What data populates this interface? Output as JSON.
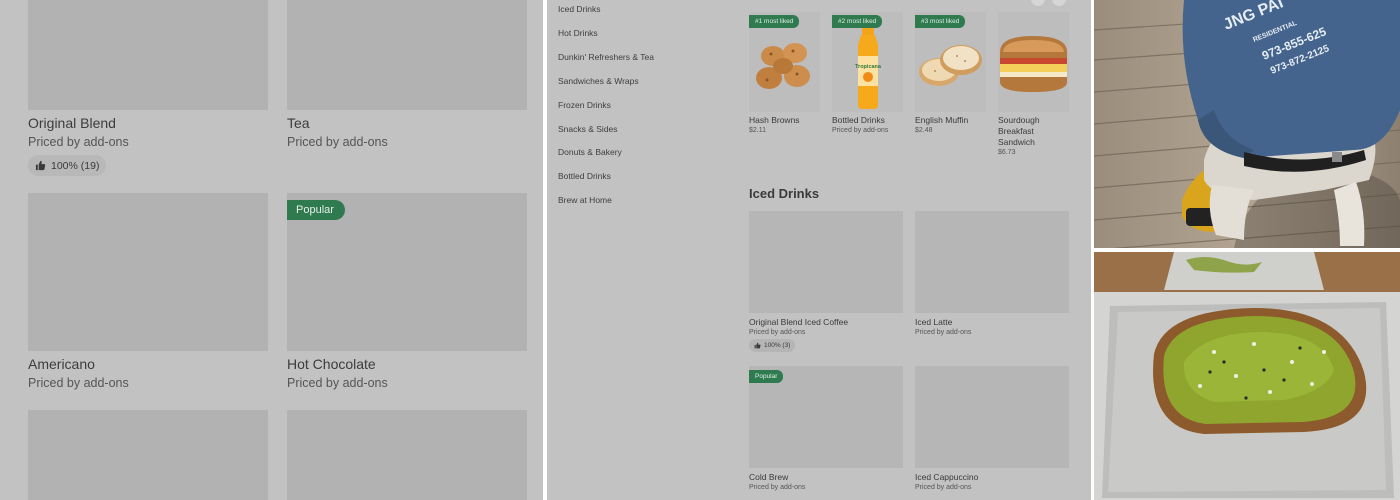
{
  "panel_left": {
    "cards": [
      {
        "name": "Original Blend",
        "price": "Priced by add-ons",
        "rating": "100% (19)"
      },
      {
        "name": "Tea",
        "price": "Priced by add-ons"
      },
      {
        "name": "Americano",
        "price": "Priced by add-ons"
      },
      {
        "name": "Hot Chocolate",
        "price": "Priced by add-ons",
        "badge": "Popular"
      }
    ]
  },
  "panel_middle": {
    "nav": [
      "Iced Drinks",
      "Hot Drinks",
      "Dunkin' Refreshers & Tea",
      "Sandwiches & Wraps",
      "Frozen Drinks",
      "Snacks & Sides",
      "Donuts & Bakery",
      "Bottled Drinks",
      "Brew at Home"
    ],
    "most_liked": [
      {
        "badge": "#1 most liked",
        "name": "Hash Browns",
        "price": "$2.11",
        "icon": "hash-browns"
      },
      {
        "badge": "#2 most liked",
        "name": "Bottled Drinks",
        "price": "Priced by add-ons",
        "icon": "orange-juice-bottle"
      },
      {
        "badge": "#3 most liked",
        "name": "English Muffin",
        "price": "$2.48",
        "icon": "english-muffin"
      },
      {
        "badge": "",
        "name": "Sourdough Breakfast Sandwich",
        "price": "$6.73",
        "icon": "sandwich"
      }
    ],
    "bottle_label": "Tropicana",
    "section_title": "Iced Drinks",
    "items": [
      {
        "name": "Original Blend Iced Coffee",
        "price": "Priced by add-ons",
        "rating": "100% (3)"
      },
      {
        "name": "Iced Latte",
        "price": "Priced by add-ons"
      },
      {
        "name": "Cold Brew",
        "price": "Priced by add-ons",
        "badge": "Popular"
      },
      {
        "name": "Iced Cappuccino",
        "price": "Priced by add-ons"
      }
    ]
  },
  "photo_top": {
    "hoodie_lines": [
      "JNG PAI",
      "RESIDENTIAL",
      "973-855-625",
      "973-872-2125"
    ]
  },
  "colors": {
    "panel_bg": "#c2c2c2",
    "placeholder": "#b2b2b2",
    "badge_green": "#2f7a4f"
  }
}
